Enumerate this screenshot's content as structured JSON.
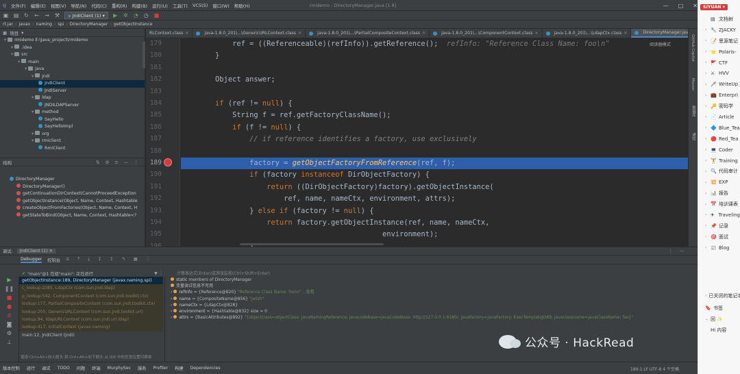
{
  "menubar": {
    "items": [
      "文件(F)",
      "编辑(E)",
      "视图(V)",
      "导航(N)",
      "代码(C)",
      "重构(R)",
      "构建(B)",
      "运行(U)",
      "工具(T)",
      "VCS(S)",
      "窗口(W)",
      "帮助(H)"
    ],
    "title": "rmidemo - DirectoryManager.java [1.8]"
  },
  "toolbar": {
    "run_config": "JndiClient (1)"
  },
  "breadcrumbs": [
    "rt.jar",
    "javax",
    "naming",
    "spi",
    "DirectoryManager",
    "getObjectInstance"
  ],
  "project": {
    "title": "项目",
    "root": "rmidemo",
    "root_path": "E:\\Java_project\\rmidemo",
    "items": [
      {
        "label": "rmidemo  E:\\Java_project\\rmidemo",
        "indent": 0,
        "type": "folder"
      },
      {
        "label": ".idea",
        "indent": 1,
        "type": "folder"
      },
      {
        "label": "src",
        "indent": 1,
        "type": "folder"
      },
      {
        "label": "main",
        "indent": 2,
        "type": "folder"
      },
      {
        "label": "java",
        "indent": 3,
        "type": "folder"
      },
      {
        "label": "jndi",
        "indent": 4,
        "type": "folder"
      },
      {
        "label": "JndiClient",
        "indent": 5,
        "type": "class",
        "selected": true
      },
      {
        "label": "JndiServer",
        "indent": 5,
        "type": "class"
      },
      {
        "label": "ldap",
        "indent": 4,
        "type": "folder"
      },
      {
        "label": "JNDILDAPServer",
        "indent": 5,
        "type": "class"
      },
      {
        "label": "method",
        "indent": 4,
        "type": "folder"
      },
      {
        "label": "SayHello",
        "indent": 5,
        "type": "class"
      },
      {
        "label": "SayHelloImpl",
        "indent": 5,
        "type": "class"
      },
      {
        "label": "org",
        "indent": 4,
        "type": "folder"
      },
      {
        "label": "rmiclient",
        "indent": 4,
        "type": "folder"
      },
      {
        "label": "RmiClient",
        "indent": 5,
        "type": "class"
      }
    ]
  },
  "structure": {
    "title": "结构",
    "items": [
      {
        "label": "DirectoryManager",
        "indent": 0,
        "type": "class"
      },
      {
        "label": "DirectoryManager()",
        "indent": 1,
        "type": "method"
      },
      {
        "label": "getContinuationDirContext(CannotProceedException",
        "indent": 1,
        "type": "method"
      },
      {
        "label": "getObjectInstance(Object, Name, Context, Hashtable",
        "indent": 1,
        "type": "method"
      },
      {
        "label": "createObjectFromFactories(Object, Name, Context, H",
        "indent": 1,
        "type": "method"
      },
      {
        "label": "getStateToBind(Object, Name, Context, Hashtable<?",
        "indent": 1,
        "type": "method"
      }
    ]
  },
  "tabs": [
    "RLContext.class",
    "java-1.8.0_201\\...\\GenericURLContext.class",
    "java-1.8.0_201\\...\\PartialCompositeContext.class",
    "java-1.8.0_201\\...\\ComponentContext.class",
    "java-1.8.0_201\\...\\LdapCtx.class",
    "DirectoryManager.java"
  ],
  "active_tab": 5,
  "reader_mode": "阅读器模式",
  "line_numbers": [
    "179",
    "180",
    "181",
    "182",
    "183",
    "184",
    "185",
    "186",
    "187",
    "188",
    "189",
    "190",
    "191",
    "192",
    "193",
    "194",
    "195",
    "196"
  ],
  "code": {
    "l179a": "            ref = ((Referenceable)(refInfo)).getReference();",
    "l179b": "  refInfo: \"Reference Class Name: foo\\n\"",
    "l180": "        }",
    "l182": "        Object answer;",
    "l184a": "        ",
    "l184kw": "if",
    "l184b": " (ref != ",
    "l184n": "null",
    "l184c": ") {",
    "l185a": "            String f = ref.getFactoryClassName();",
    "l186a": "            ",
    "l186kw": "if",
    "l186b": " (f != ",
    "l186n": "null",
    "l186c": ") {",
    "l187": "                // if reference identifies a factory, use exclusively",
    "l189a": "                factory = ",
    "l189it": "getObjectFactoryFromReference",
    "l189b": "(ref, f);",
    "l190a": "                ",
    "l190kw": "if",
    "l190b": " (factory ",
    "l190kw2": "instanceof",
    "l190c": " DirObjectFactory) {",
    "l191a": "                    ",
    "l191kw": "return",
    "l191b": " ((DirObjectFactory)factory).getObjectInstance(",
    "l192": "                        ref, name, nameCtx, environment, attrs);",
    "l193a": "                } ",
    "l193kw": "else if",
    "l193b": " (factory != ",
    "l193n": "null",
    "l193c": ") {",
    "l194a": "                    ",
    "l194kw": "return",
    "l194b": " factory.getObjectInstance(ref, name, nameCtx,",
    "l195": "                                               environment);",
    "l196": "                }"
  },
  "right_strip": [
    "GitHub Copilot",
    "Maven",
    "数据库",
    "通知"
  ],
  "debug": {
    "title": "调试:",
    "config": "JndiClient (1)",
    "tabs": [
      "Debugger",
      "控制台"
    ],
    "thread": "\"main\"@1 在组\"main\": 正在运行",
    "eval_hint": "计算表达式(Enter)或添加监视(Ctrl+Shift+Enter)",
    "frames": [
      {
        "text": "getObjectInstance:189, DirectoryManager (javax.naming.spi)",
        "kind": "sel"
      },
      {
        "text": "c_lookup:1085, LdapCtx (com.sun.jndi.ldap)",
        "kind": "dim"
      },
      {
        "text": "p_lookup:542, ComponentContext (com.sun.jndi.toolkit.ctx)",
        "kind": "dim"
      },
      {
        "text": "lookup:177, PartialCompositeContext (com.sun.jndi.toolkit.ctx)",
        "kind": "dim"
      },
      {
        "text": "lookup:205, GenericURLContext (com.sun.jndi.toolkit.url)",
        "kind": "dim"
      },
      {
        "text": "lookup:94, ldapURLContext (com.sun.jndi.url.ldap)",
        "kind": "dim"
      },
      {
        "text": "lookup:417, InitialContext (javax.naming)",
        "kind": "dim"
      },
      {
        "text": "main:12, JndiClient (jndi)",
        "kind": "normal"
      }
    ],
    "vars": [
      {
        "name": "static",
        "val": " members of DirectoryManager",
        "str": ""
      },
      {
        "name": "",
        "val": "变量调试信息不可用",
        "str": ""
      },
      {
        "name": "refInfo",
        "val": " = {Reference@820} ",
        "str": "\"Reference Class Name: foo\\n\" ...查看"
      },
      {
        "name": "name",
        "val": " = {CompositeName@856} ",
        "str": "\"jwtzh\""
      },
      {
        "name": "nameCtx",
        "val": " = {LdapCtx@828}",
        "str": ""
      },
      {
        "name": "environment",
        "val": " = {Hashtable@832}  size = 0",
        "str": ""
      },
      {
        "name": "attrs",
        "val": " = {BasicAttributes@892} ",
        "str": "\"{objectclass=objectClass: javaNamingReference, javacodebase=javaCodeBase: http://127.0.0.1:8180/, javafactory=javaFactory: ExecTemplateJDK8, javaclassname=javaClassName: foo}\""
      }
    ],
    "switch_hint": "使用 Ctrl+Alt+向上箭头 和 Ctrl+Alt+向下箭头 从 IDE 中的任意位置切换帧"
  },
  "statusbar": {
    "items": [
      "版本控制",
      "运行",
      "调试",
      "TODO",
      "问题",
      "终端",
      "MurphySec",
      "服务",
      "Profiler",
      "构建",
      "Dependencies"
    ],
    "right": "189:1   LF   UTF-8   4 个空格"
  },
  "sidebar": {
    "brand": "SIYUAN",
    "items": [
      {
        "label": "文档树",
        "emoji": "▤",
        "chev": ""
      },
      {
        "label": "ZJACKY",
        "emoji": "🔧",
        "chev": "›"
      },
      {
        "label": "思源笔记",
        "emoji": "📝",
        "chev": "›"
      },
      {
        "label": "Polaris-",
        "emoji": "⭐",
        "chev": "›"
      },
      {
        "label": "CTF",
        "emoji": "🚩",
        "chev": "›"
      },
      {
        "label": "HVV",
        "emoji": "⚔",
        "chev": "›"
      },
      {
        "label": "WriteUp",
        "emoji": "🗡",
        "chev": "›"
      },
      {
        "label": "Enterpri",
        "emoji": "💼",
        "chev": "›"
      },
      {
        "label": "密码学",
        "emoji": "🔑",
        "chev": "›"
      },
      {
        "label": "Article",
        "emoji": "📄",
        "chev": "›"
      },
      {
        "label": "Blue_Tea",
        "emoji": "🔷",
        "chev": "›"
      },
      {
        "label": "Red_Tea",
        "emoji": "🔴",
        "chev": "›"
      },
      {
        "label": "Coder",
        "emoji": "💻",
        "chev": "›"
      },
      {
        "label": "Training",
        "emoji": "🏋",
        "chev": "›"
      },
      {
        "label": "代码审计",
        "emoji": "🔍",
        "chev": "›"
      },
      {
        "label": "EXP",
        "emoji": "💥",
        "chev": "›"
      },
      {
        "label": "报告",
        "emoji": "📊",
        "chev": "›"
      },
      {
        "label": "培训课表",
        "emoji": "📅",
        "chev": "›"
      },
      {
        "label": "Traveling",
        "emoji": "✈",
        "chev": "›"
      },
      {
        "label": "记录",
        "emoji": "📌",
        "chev": "›"
      },
      {
        "label": "面试",
        "emoji": "🎯",
        "chev": "›"
      },
      {
        "label": "Blog",
        "emoji": "📰",
        "chev": "›"
      }
    ],
    "closed": "已关闭的笔记本",
    "bookmarks": "书签",
    "bm1": "回 ✨",
    "bm2": "Hi 内容"
  },
  "watermark": "公众号 · HackRead",
  "colors": {
    "highlight": "#2d5fad",
    "keyword": "#cc7832",
    "brand": "#d83b3b"
  }
}
